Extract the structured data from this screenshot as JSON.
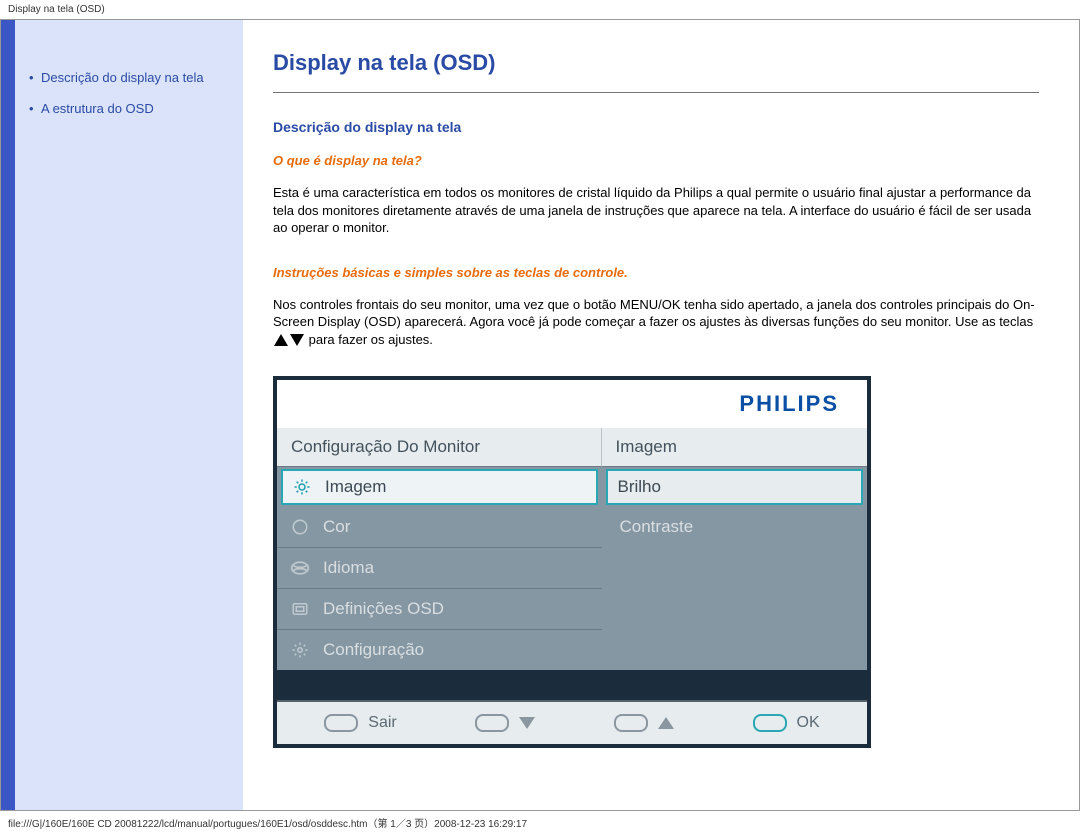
{
  "header_crumb": "Display na tela (OSD)",
  "sidebar": {
    "items": [
      {
        "label": "Descrição do display na tela"
      },
      {
        "label": "A estrutura do OSD"
      }
    ]
  },
  "content": {
    "page_title": "Display na tela (OSD)",
    "section1_title": "Descrição do display na tela",
    "sub1": "O que é display na tela?",
    "para1": "Esta é uma característica em todos os monitores de cristal líquido da Philips a qual permite o usuário final ajustar a performance da tela dos monitores diretamente através de uma janela de instruções que aparece na tela. A interface do usuário é fácil de ser usada ao operar o monitor.",
    "sub2": "Instruções básicas e simples sobre as teclas de controle.",
    "para2a": "Nos controles frontais do seu monitor,  uma vez que o botão MENU/OK tenha sido apertado, a janela dos controles principais do On-Screen Display (OSD) aparecerá. Agora você já pode começar a fazer os ajustes às diversas funções do seu monitor. Use as teclas",
    "para2b": "para fazer os ajustes."
  },
  "osd": {
    "brand": "PHILIPS",
    "left_header": "Configuração Do Monitor",
    "right_header": "Imagem",
    "left_items": [
      {
        "icon": "brightness-icon",
        "label": "Imagem",
        "selected": true
      },
      {
        "icon": "color-icon",
        "label": "Cor"
      },
      {
        "icon": "language-icon",
        "label": "Idioma"
      },
      {
        "icon": "osd-icon",
        "label": "Definições OSD"
      },
      {
        "icon": "settings-icon",
        "label": "Configuração"
      }
    ],
    "right_items": [
      {
        "label": "Brilho",
        "selected": true
      },
      {
        "label": "Contraste"
      }
    ],
    "footer": {
      "exit": "Sair",
      "ok": "OK"
    }
  },
  "footer_line": "file:///G|/160E/160E CD 20081222/lcd/manual/portugues/160E1/osd/osddesc.htm（第 1／3 页）2008-12-23 16:29:17"
}
